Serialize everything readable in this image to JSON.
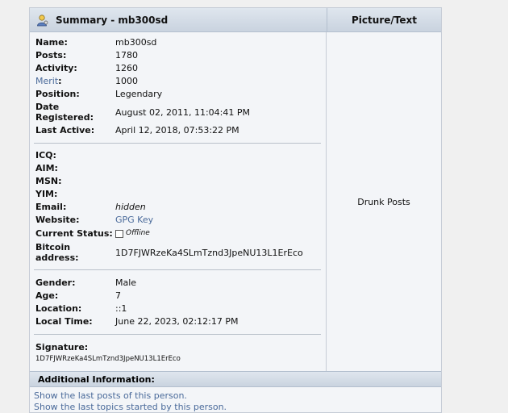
{
  "header": {
    "summary_title": "Summary - mb300sd",
    "picture_title": "Picture/Text"
  },
  "fields": {
    "name": {
      "label": "Name:",
      "value": "mb300sd"
    },
    "posts": {
      "label": "Posts:",
      "value": "1780"
    },
    "activity": {
      "label": "Activity:",
      "value": "1260"
    },
    "merit": {
      "label": "Merit",
      "colon": ":",
      "value": "1000"
    },
    "position": {
      "label": "Position:",
      "value": "Legendary"
    },
    "date_registered": {
      "label_line1": "Date",
      "label_line2": "Registered:",
      "value": "August 02, 2011, 11:04:41 PM"
    },
    "last_active": {
      "label": "Last Active:",
      "value": "April 12, 2018, 07:53:22 PM"
    },
    "icq": {
      "label": "ICQ:"
    },
    "aim": {
      "label": "AIM:"
    },
    "msn": {
      "label": "MSN:"
    },
    "yim": {
      "label": "YIM:"
    },
    "email": {
      "label": "Email:",
      "value": "hidden"
    },
    "website": {
      "label": "Website:",
      "value": "GPG Key"
    },
    "current_status": {
      "label": "Current Status:",
      "value": "Offline"
    },
    "bitcoin": {
      "label_line1": "Bitcoin",
      "label_line2": "address:",
      "value": "1D7FJWRzeKa4SLmTznd3JpeNU13L1ErEco"
    },
    "gender": {
      "label": "Gender:",
      "value": "Male"
    },
    "age": {
      "label": "Age:",
      "value": "7"
    },
    "location": {
      "label": "Location:",
      "value": "::1"
    },
    "local_time": {
      "label": "Local Time:",
      "value": "June 22, 2023, 02:12:17 PM"
    },
    "signature": {
      "label": "Signature:",
      "value": "1D7FJWRzeKa4SLmTznd3JpeNU13L1ErEco"
    }
  },
  "picture_text": "Drunk Posts",
  "additional": {
    "title": "Additional Information:",
    "links": [
      "Show the last posts of this person.",
      "Show the last topics started by this person."
    ]
  },
  "colors": {
    "link": "#4a6a9a",
    "header_bg": "#c9d3df",
    "panel_bg": "#f3f5f8"
  }
}
